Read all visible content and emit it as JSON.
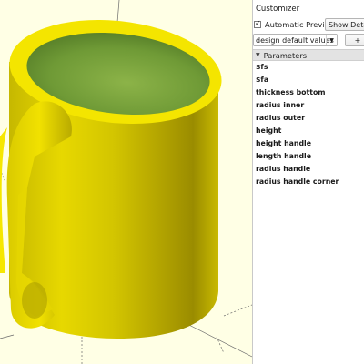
{
  "customizer": {
    "title": "Customizer",
    "automatic_preview_label": "Automatic Preview",
    "automatic_preview_checked": true,
    "show_details_label": "Show Details",
    "preset_value": "design default values",
    "add_preset_label": "+",
    "parameters_header": "Parameters",
    "parameters": [
      "$fs",
      "$fa",
      "thickness bottom",
      "radius inner",
      "radius outer",
      "height",
      "height handle",
      "length handle",
      "radius handle",
      "radius handle corner"
    ]
  },
  "viewport": {
    "background_color": "#ffffe5",
    "model_color": "#f2e200",
    "interior_color": "#6e9a35"
  }
}
